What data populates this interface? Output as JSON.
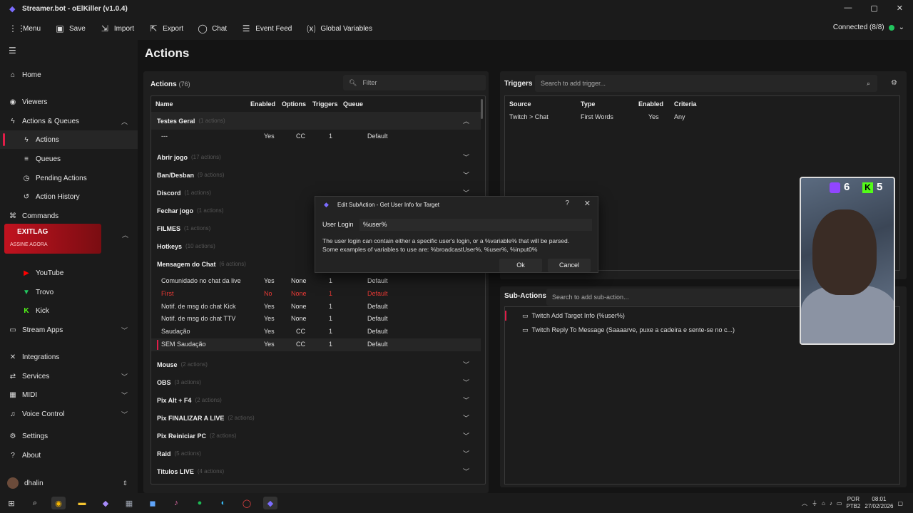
{
  "window": {
    "title": "Streamer.bot - oElKiller (v1.0.4)",
    "controls": [
      "—",
      "▢",
      "✕"
    ]
  },
  "toolbar": {
    "items": [
      "Menu",
      "Save",
      "Import",
      "Export",
      "Chat",
      "Event Feed",
      "Global Variables"
    ],
    "status": "Connected (8/8)",
    "accent": "#22c55e"
  },
  "sidebar": {
    "items": [
      {
        "label": "Home",
        "icon": "home-icon"
      },
      {
        "label": "Viewers",
        "icon": "users-icon"
      },
      {
        "label": "Actions & Queues",
        "icon": "bolt-icon",
        "expanded": true
      },
      {
        "label": "Actions",
        "icon": "action-icon",
        "active": true
      },
      {
        "label": "Queues",
        "icon": "queue-icon"
      },
      {
        "label": "Pending Actions",
        "icon": "pending-icon"
      },
      {
        "label": "Action History",
        "icon": "history-icon"
      },
      {
        "label": "Commands",
        "icon": "commands-icon"
      },
      {
        "label": "YouTube",
        "icon": "youtube-icon"
      },
      {
        "label": "Trovo",
        "icon": "trovo-icon"
      },
      {
        "label": "Kick",
        "icon": "kick-icon"
      },
      {
        "label": "Stream Apps",
        "icon": "apps-icon"
      },
      {
        "label": "Integrations",
        "icon": "integrations-icon"
      },
      {
        "label": "Services",
        "icon": "services-icon"
      },
      {
        "label": "MIDI",
        "icon": "midi-icon"
      },
      {
        "label": "Voice Control",
        "icon": "mic-icon"
      },
      {
        "label": "Settings",
        "icon": "gear-icon"
      },
      {
        "label": "About",
        "icon": "help-icon"
      }
    ],
    "banner": {
      "title": "EXITLAG",
      "subtitle": "ASSINE AGORA"
    },
    "user": "dhalin"
  },
  "main": {
    "title": "Actions",
    "actions": {
      "heading": "Actions",
      "count": "(76)",
      "filter_placeholder": "Filter",
      "columns": [
        "Name",
        "Enabled",
        "Options",
        "Triggers",
        "Queue"
      ],
      "groups": [
        {
          "name": "Testes Geral",
          "count": "(1 actions)"
        },
        {
          "name": "Abrir jogo",
          "count": "(17 actions)"
        },
        {
          "name": "Ban/Desban",
          "count": "(9 actions)"
        },
        {
          "name": "Discord",
          "count": "(1 actions)"
        },
        {
          "name": "Fechar jogo",
          "count": "(1 actions)"
        },
        {
          "name": "FILMES",
          "count": "(1 actions)"
        },
        {
          "name": "Hotkeys",
          "count": "(10 actions)"
        },
        {
          "name": "Mensagem do Chat",
          "count": "(6 actions)"
        },
        {
          "name": "Mouse",
          "count": "(2 actions)"
        },
        {
          "name": "OBS",
          "count": "(3 actions)"
        },
        {
          "name": "Pix Alt + F4",
          "count": "(2 actions)"
        },
        {
          "name": "Pix FINALIZAR A LIVE",
          "count": "(2 actions)"
        },
        {
          "name": "Pix Reiniciar PC",
          "count": "(2 actions)"
        },
        {
          "name": "Raid",
          "count": "(5 actions)"
        },
        {
          "name": "Titulos LIVE",
          "count": "(4 actions)"
        }
      ],
      "rows": [
        {
          "name": "---",
          "enabled": "Yes",
          "options": "CC",
          "triggers": "1",
          "queue": "Default"
        },
        {
          "name": "Comunidado no chat da live",
          "enabled": "Yes",
          "options": "None",
          "triggers": "1",
          "queue": "Default"
        },
        {
          "name": "First",
          "enabled": "No",
          "options": "None",
          "triggers": "1",
          "queue": "Default"
        },
        {
          "name": "Notif. de msg do chat Kick",
          "enabled": "Yes",
          "options": "None",
          "triggers": "1",
          "queue": "Default"
        },
        {
          "name": "Notif. de msg do chat TTV",
          "enabled": "Yes",
          "options": "None",
          "triggers": "1",
          "queue": "Default"
        },
        {
          "name": "Saudação",
          "enabled": "Yes",
          "options": "CC",
          "triggers": "1",
          "queue": "Default"
        },
        {
          "name": "SEM Saudação",
          "enabled": "Yes",
          "options": "CC",
          "triggers": "1",
          "queue": "Default"
        }
      ]
    },
    "triggers": {
      "heading": "Triggers",
      "search_placeholder": "Search to add trigger...",
      "columns": [
        "Source",
        "Type",
        "Enabled",
        "Criteria"
      ],
      "rows": [
        {
          "source": "Twitch > Chat",
          "type": "First Words",
          "enabled": "Yes",
          "criteria": "Any"
        }
      ]
    },
    "subactions": {
      "heading": "Sub-Actions",
      "search_placeholder": "Search to add sub-action...",
      "items": [
        "Twitch Add Target Info (%user%)",
        "Twitch Reply To Message (Saaaarve, puxe a cadeira e sente-se no c...)"
      ]
    }
  },
  "dialog": {
    "title": "Edit SubAction - Get User Info for Target",
    "help_icon": "?",
    "label": "User Login",
    "value": "%user%",
    "help_line1": "The user login can contain either a specific user's login, or a %variable% that will be parsed.",
    "help_line2": "Some examples of variables to use are: %broadcastUser%, %user%, %input0%",
    "ok": "Ok",
    "cancel": "Cancel"
  },
  "overlay": {
    "twitch_count": "6",
    "kick_count": "5",
    "twitch_color": "#9146ff",
    "kick_color": "#53fc18"
  },
  "taskbar": {
    "lang1": "POR",
    "lang2": "PTB2",
    "time": "08:01",
    "date": "27/02/2026"
  }
}
